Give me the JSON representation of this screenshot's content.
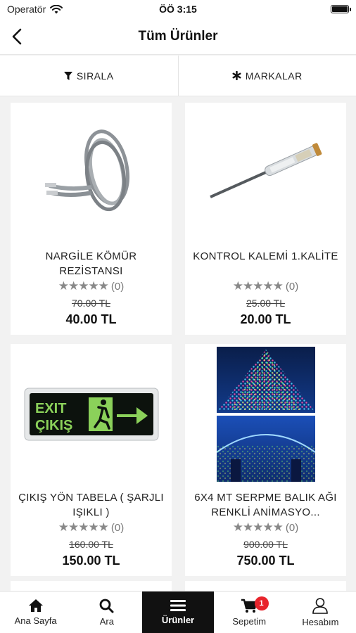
{
  "status_bar": {
    "carrier": "Operatör",
    "time": "ÖÖ 3:15"
  },
  "header": {
    "title": "Tüm Ürünler"
  },
  "filters": {
    "sort_label": "SIRALA",
    "brands_label": "MARKALAR"
  },
  "products": [
    {
      "name": "NARGİLE KÖMÜR REZİSTANSI",
      "stars": "★★★★★",
      "reviews": "(0)",
      "old_price": "70.00 TL",
      "price": "40.00 TL",
      "image_icon": "coil-icon"
    },
    {
      "name": "KONTROL KALEMİ 1.KALİTE",
      "stars": "★★★★★",
      "reviews": "(0)",
      "old_price": "25.00 TL",
      "price": "20.00 TL",
      "image_icon": "screwdriver-icon"
    },
    {
      "name": "ÇIKIŞ YÖN TABELA ( ŞARJLI IŞIKLI )",
      "stars": "★★★★★",
      "reviews": "(0)",
      "old_price": "160.00 TL",
      "price": "150.00 TL",
      "image_icon": "exit-sign-icon",
      "sign_text": [
        "EXIT",
        "ÇIKIŞ"
      ]
    },
    {
      "name": "6X4 MT SERPME BALIK AĞI RENKLİ ANİMASYO...",
      "stars": "★★★★★",
      "reviews": "(0)",
      "old_price": "900.00 TL",
      "price": "750.00 TL",
      "image_icon": "led-lights-icon"
    }
  ],
  "tabbar": {
    "items": [
      {
        "label": "Ana Sayfa",
        "icon": "home-icon"
      },
      {
        "label": "Ara",
        "icon": "search-icon"
      },
      {
        "label": "Ürünler",
        "icon": "menu-icon"
      },
      {
        "label": "Sepetim",
        "icon": "cart-icon",
        "badge": "1"
      },
      {
        "label": "Hesabım",
        "icon": "user-icon"
      }
    ]
  },
  "colors": {
    "accent_active": "#111111",
    "badge": "#e8242c"
  }
}
